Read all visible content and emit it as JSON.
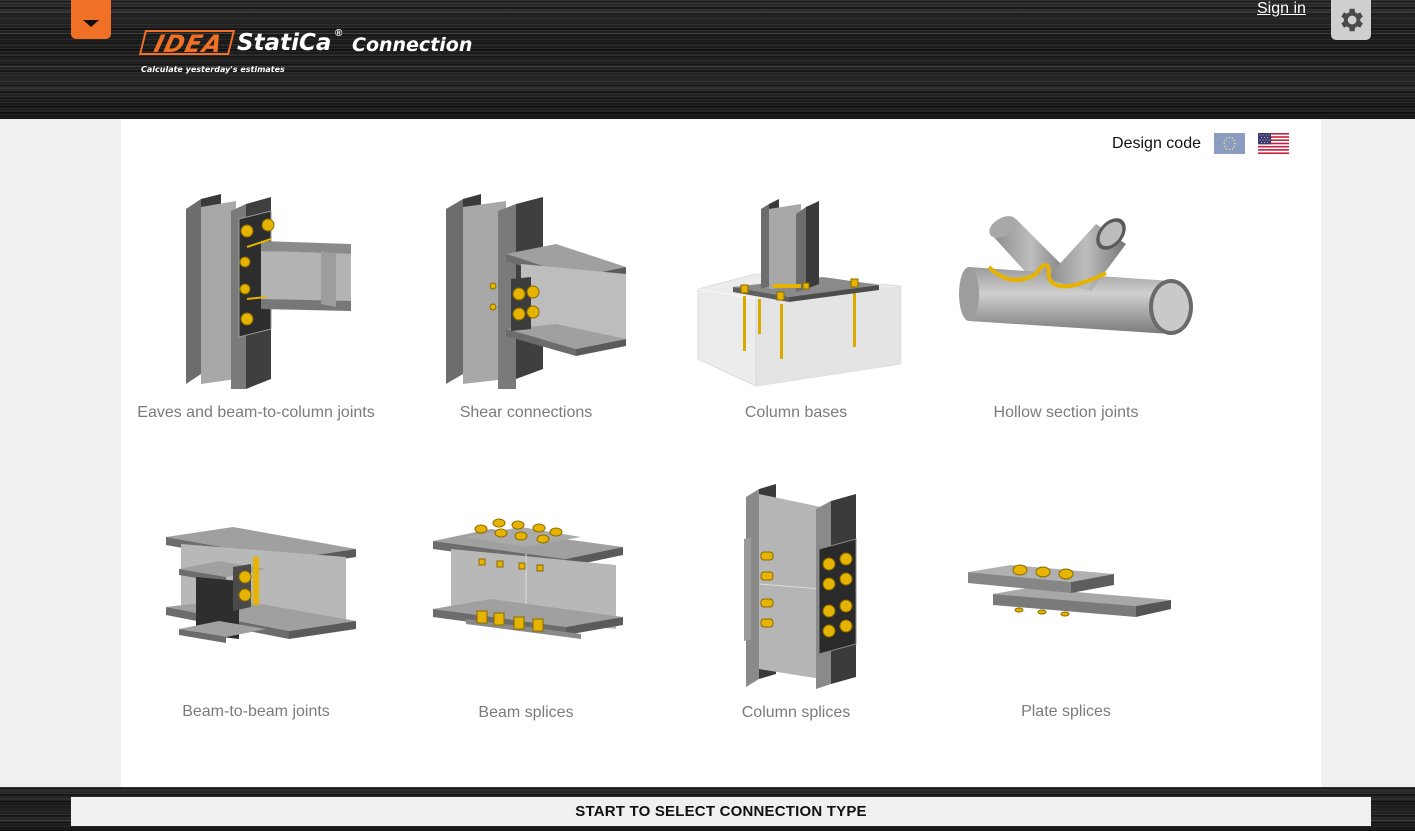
{
  "header": {
    "menu_button_icon": "caret-down-icon",
    "logo": {
      "brand_mark": "IDEA",
      "brand_name": "StatiCa",
      "registered": "®",
      "product": "Connection",
      "tagline": "Calculate yesterday's estimates"
    },
    "sign_in_label": "Sign in",
    "settings_icon": "gear-icon"
  },
  "design_code": {
    "label": "Design code",
    "options": [
      {
        "name": "EU",
        "icon": "eu-flag-icon"
      },
      {
        "name": "US",
        "icon": "us-flag-icon"
      }
    ]
  },
  "connection_types": [
    {
      "label": "Eaves and beam-to-column joints",
      "icon": "eaves-joint-icon"
    },
    {
      "label": "Shear connections",
      "icon": "shear-connection-icon"
    },
    {
      "label": "Column bases",
      "icon": "column-base-icon"
    },
    {
      "label": "Hollow section joints",
      "icon": "hollow-section-icon"
    },
    {
      "label": "Beam-to-beam joints",
      "icon": "beam-to-beam-icon"
    },
    {
      "label": "Beam splices",
      "icon": "beam-splice-icon"
    },
    {
      "label": "Column splices",
      "icon": "column-splice-icon"
    },
    {
      "label": "Plate splices",
      "icon": "plate-splice-icon"
    }
  ],
  "footer": {
    "start_label": "START TO SELECT CONNECTION TYPE"
  },
  "colors": {
    "accent": "#f07026",
    "steel": "#9a9a9a",
    "bolt": "#e0b000"
  }
}
